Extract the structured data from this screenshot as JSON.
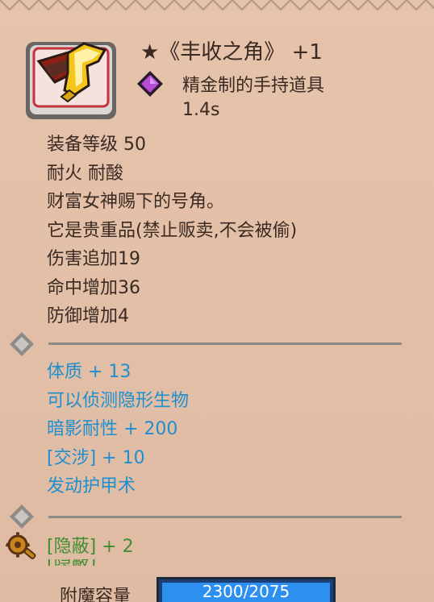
{
  "item": {
    "title": "★《丰收之角》 +1",
    "type_text": "精金制的手持道具",
    "speed": "1.4s",
    "portrait_icon": "golden-horn-icon",
    "type_icon": "purple-gem-icon"
  },
  "stats": [
    "装备等级 50",
    "耐火  耐酸",
    "财富女神赐下的号角。",
    "它是贵重品(禁止贩卖,不会被偷)",
    "伤害追加19",
    "命中增加36",
    "防御增加4"
  ],
  "bonuses": [
    "体质 + 13",
    "可以侦测隐形生物",
    "暗影耐性 + 200",
    "[交涉] + 10",
    "发动护甲术"
  ],
  "extra": {
    "label": "[隐蔽] + 2",
    "cut_text": "[隐蔽]"
  },
  "enchant": {
    "label": "附魔容量",
    "value": "2300/2075",
    "fill_fraction": 1.0
  },
  "colors": {
    "bonus": "#1f8fce",
    "green": "#3f8f32",
    "text": "#3a2a22",
    "bar_fill": "#2d8ff0"
  }
}
